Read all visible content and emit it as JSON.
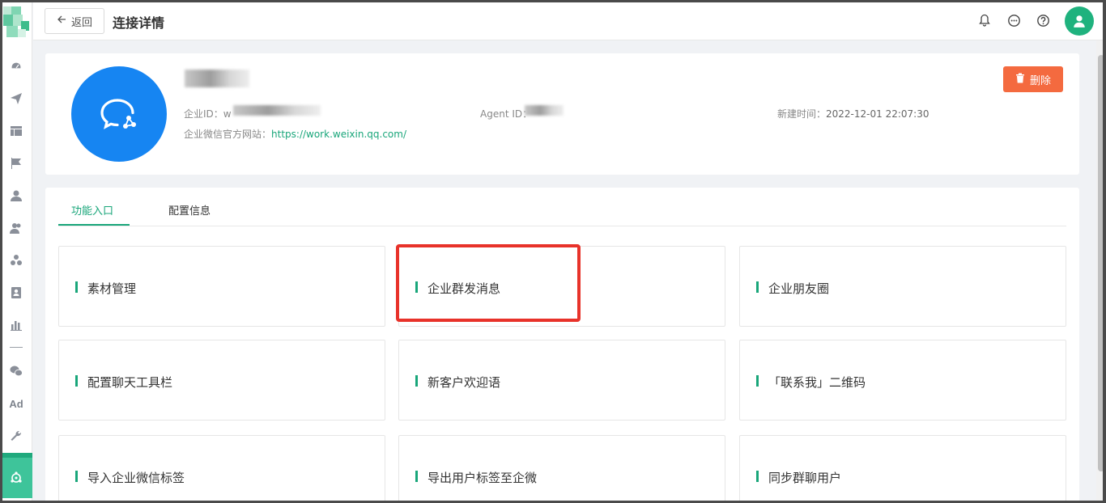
{
  "header": {
    "back_label": "返回",
    "title": "连接详情"
  },
  "sidebar": {
    "items": [
      {
        "icon": "dashboard-icon"
      },
      {
        "icon": "send-icon"
      },
      {
        "icon": "layout-icon"
      },
      {
        "icon": "flag-icon"
      },
      {
        "icon": "user-icon"
      },
      {
        "icon": "users-icon"
      },
      {
        "icon": "group-icon"
      },
      {
        "icon": "contact-card-icon"
      },
      {
        "icon": "bar-chart-icon"
      },
      {
        "icon": "wechat-icon"
      },
      {
        "icon": "ad-icon",
        "label": "Ad"
      },
      {
        "icon": "wrench-icon"
      },
      {
        "icon": "wecom-icon",
        "active": true
      }
    ]
  },
  "profile": {
    "corp_id_label": "企业ID：",
    "corp_id_value": "w",
    "agent_id_label": "Agent ID：",
    "created_label": "新建时间：",
    "created_value": "2022-12-01 22:07:30",
    "site_label": "企业微信官方网站：",
    "site_url": "https://work.weixin.qq.com/",
    "delete_label": "删除"
  },
  "tabs": [
    {
      "label": "功能入口",
      "active": true
    },
    {
      "label": "配置信息",
      "active": false
    }
  ],
  "functions": [
    "素材管理",
    "企业群发消息",
    "企业朋友圈",
    "配置聊天工具栏",
    "新客户欢迎语",
    "「联系我」二维码",
    "导入企业微信标签",
    "导出用户标签至企微",
    "同步群聊用户"
  ],
  "colors": {
    "accent": "#19a67a",
    "delete": "#f46a3f",
    "avatar": "#1685f2",
    "highlight": "#e8322a"
  }
}
